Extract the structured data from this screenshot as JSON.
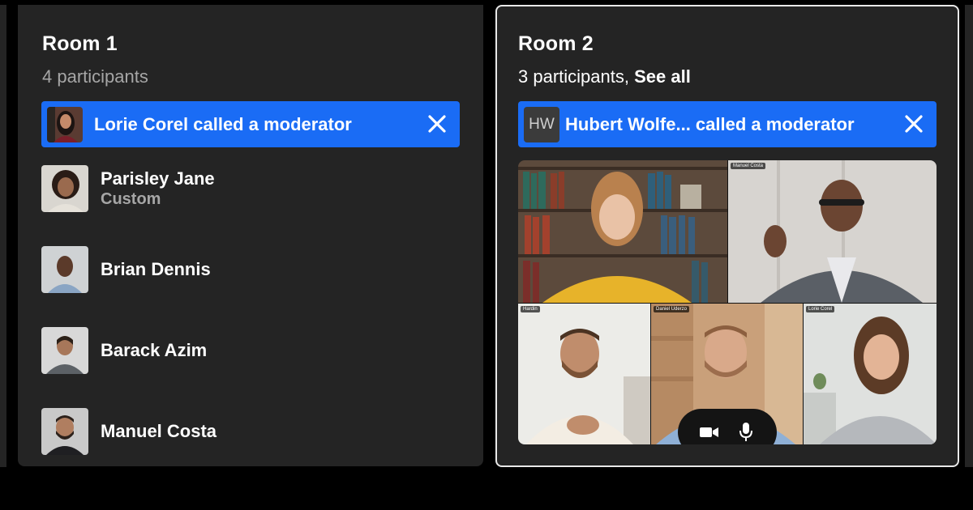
{
  "rooms": [
    {
      "title": "Room 1",
      "subtitle": "4 participants",
      "alert": {
        "text": "Lorie Corel called a moderator"
      },
      "participants": [
        {
          "name": "Parisley Jane",
          "role": "Custom"
        },
        {
          "name": "Brian Dennis"
        },
        {
          "name": "Barack Azim"
        },
        {
          "name": "Manuel Costa"
        }
      ]
    },
    {
      "title": "Room 2",
      "subtitle": "3 participants,",
      "see_all": "See all",
      "alert": {
        "initials": "HW",
        "text": "Hubert Wolfe... called a moderator"
      },
      "video_tiles": [
        {
          "name_tag": ""
        },
        {
          "name_tag": "Manuel Costa"
        },
        {
          "name_tag": "Hardin"
        },
        {
          "name_tag": "Daniel Uderzo"
        },
        {
          "name_tag": "Lorie Corel"
        }
      ],
      "controls": [
        "camera-icon",
        "microphone-icon"
      ]
    }
  ],
  "colors": {
    "background": "#000000",
    "panel": "#242424",
    "accent": "#1a6cf5",
    "muted_text": "#a6a6a6",
    "selected_border": "#e9e9e9"
  }
}
